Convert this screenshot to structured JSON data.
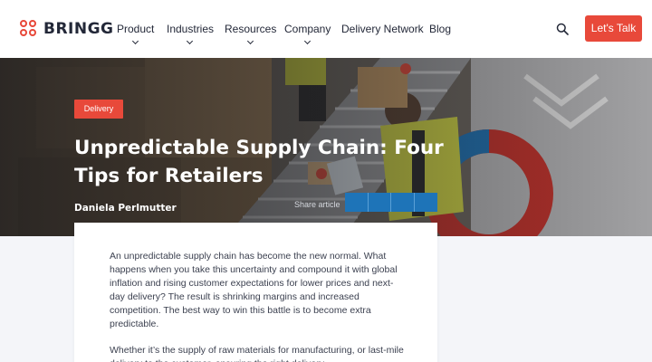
{
  "brand": {
    "name": "BRINGG",
    "color": "#e8493a"
  },
  "nav": {
    "items": [
      {
        "label": "Product",
        "has_dropdown": true
      },
      {
        "label": "Industries",
        "has_dropdown": true
      },
      {
        "label": "Resources",
        "has_dropdown": true
      },
      {
        "label": "Company",
        "has_dropdown": true
      },
      {
        "label": "Delivery Network",
        "has_dropdown": false
      },
      {
        "label": "Blog",
        "has_dropdown": false
      }
    ],
    "search_icon": "search-icon",
    "cta_label": "Let's Talk"
  },
  "hero": {
    "category": "Delivery",
    "title": "Unpredictable Supply Chain: Four Tips for Retailers",
    "author": "Daniela Perlmutter",
    "share_label": "Share article",
    "share_icons": [
      "linkedin-icon",
      "twitter-icon",
      "facebook-icon",
      "email-icon"
    ]
  },
  "article": {
    "paragraphs": [
      "An unpredictable supply chain has become the new normal. What happens when you take this uncertainty and compound it with global inflation and rising customer expectations for lower prices and next-day delivery? The result is shrinking margins and increased competition. The best way to win this battle is to become extra predictable.",
      "Whether it’s the supply of raw materials for manufacturing, or last-mile delivery to the customer, ensuring the right delivery"
    ]
  },
  "colors": {
    "accent": "#e8493a",
    "share": "#1e74b8",
    "text": "#232838"
  }
}
